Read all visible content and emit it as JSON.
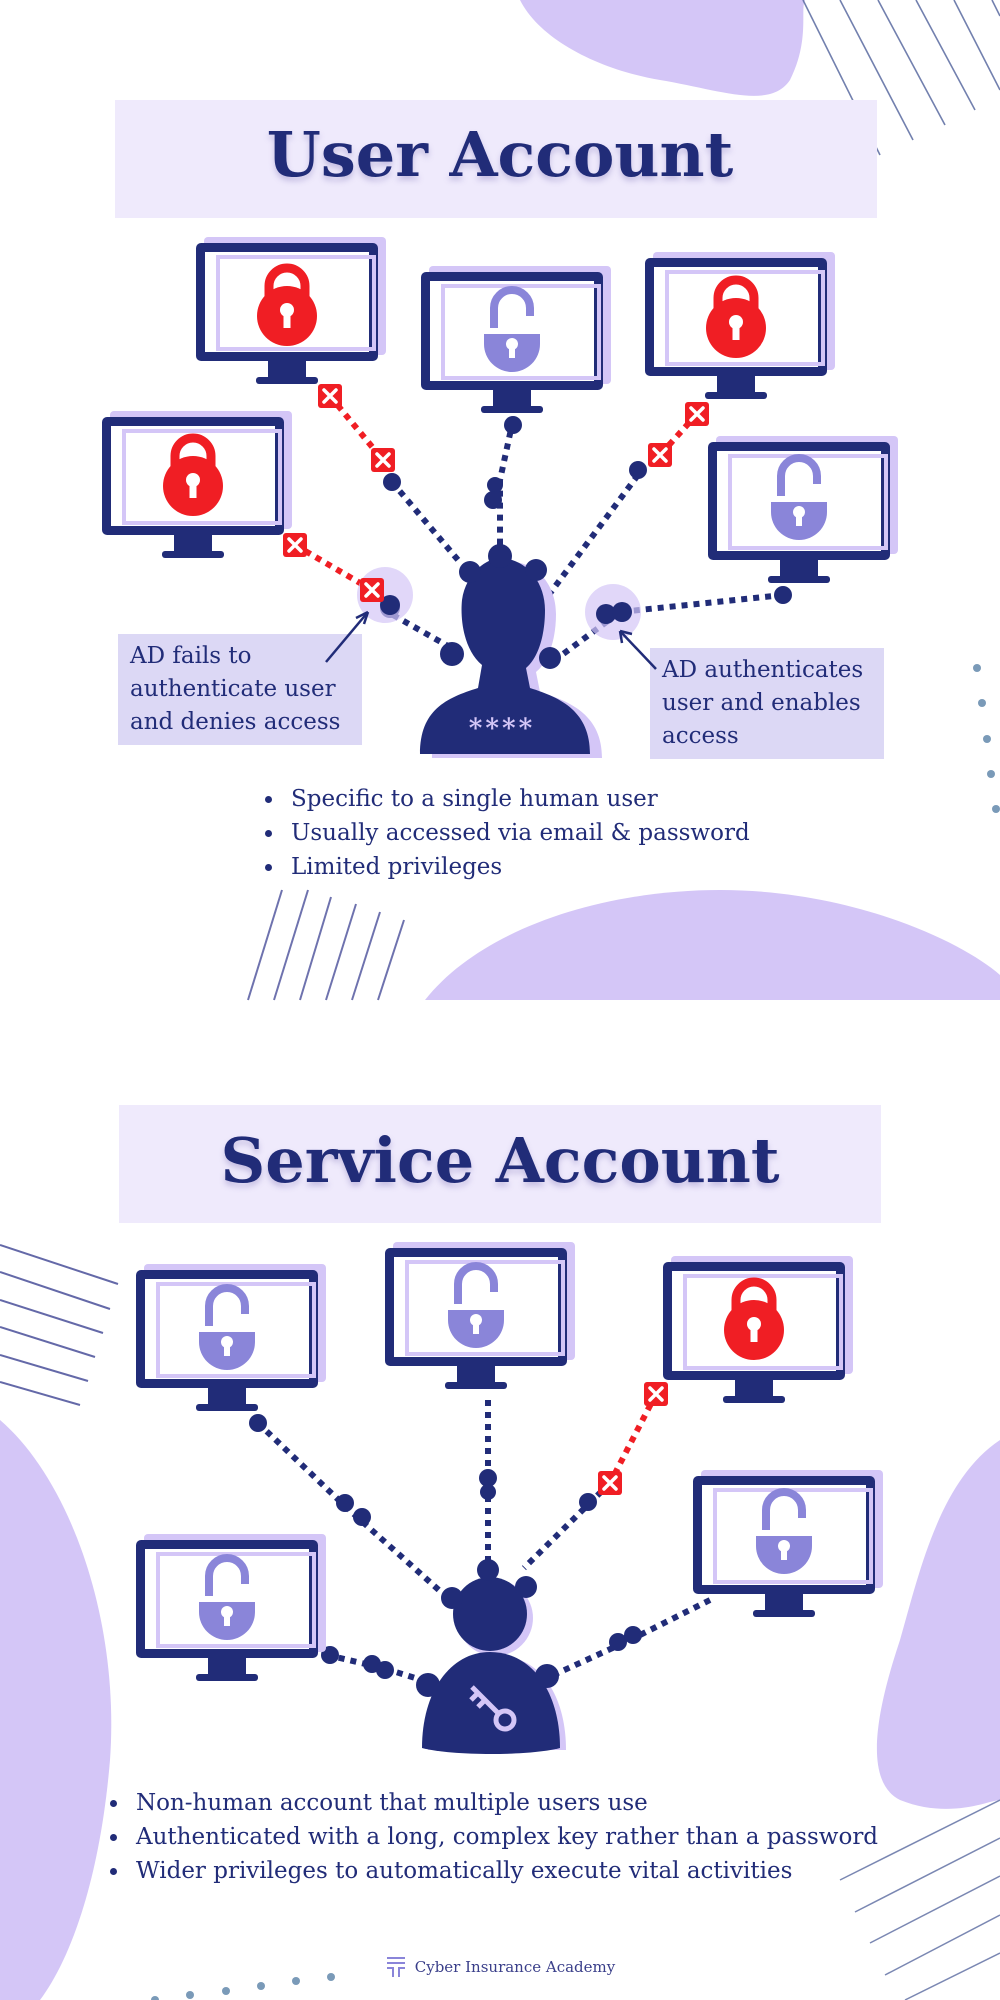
{
  "colors": {
    "navy": "#212c78",
    "lavender": "#d4c6f7",
    "lavender_light": "#efeafc",
    "callout_bg": "#dcd8f5",
    "lock_locked": "#f01e24",
    "lock_unlocked": "#8a85d9",
    "deny_red": "#f01e24",
    "stripe_line": "#5a6aa0",
    "dot_gray": "#7a9ab8"
  },
  "user_section": {
    "title": "User Account",
    "monitors": [
      {
        "id": "top-left",
        "lock": "locked",
        "access": "denied"
      },
      {
        "id": "top-center",
        "lock": "unlocked",
        "access": "granted"
      },
      {
        "id": "top-right",
        "lock": "locked",
        "access": "denied"
      },
      {
        "id": "mid-left",
        "lock": "locked",
        "access": "denied"
      },
      {
        "id": "mid-right",
        "lock": "unlocked",
        "access": "granted"
      }
    ],
    "user_icon": "person-silhouette-icon",
    "password_mask": "****",
    "callout_left": "AD fails to authenticate user and denies access",
    "callout_right": "AD authenticates user and enables access",
    "bullets": [
      "Specific to a single human user",
      "Usually accessed via email & password",
      "Limited privileges"
    ]
  },
  "service_section": {
    "title": "Service Account",
    "monitors": [
      {
        "id": "top-left",
        "lock": "unlocked",
        "access": "granted"
      },
      {
        "id": "top-center",
        "lock": "unlocked",
        "access": "granted"
      },
      {
        "id": "top-right",
        "lock": "locked",
        "access": "denied"
      },
      {
        "id": "mid-left",
        "lock": "unlocked",
        "access": "granted"
      },
      {
        "id": "mid-right",
        "lock": "unlocked",
        "access": "granted"
      }
    ],
    "service_icon": "robot-key-icon",
    "bullets": [
      "Non-human account that multiple users use",
      "Authenticated with a long, complex key rather than a password",
      "Wider privileges to automatically execute vital activities"
    ]
  },
  "footer": {
    "brand": "Cyber Insurance Academy",
    "logo_icon": "shield-logo-icon"
  }
}
